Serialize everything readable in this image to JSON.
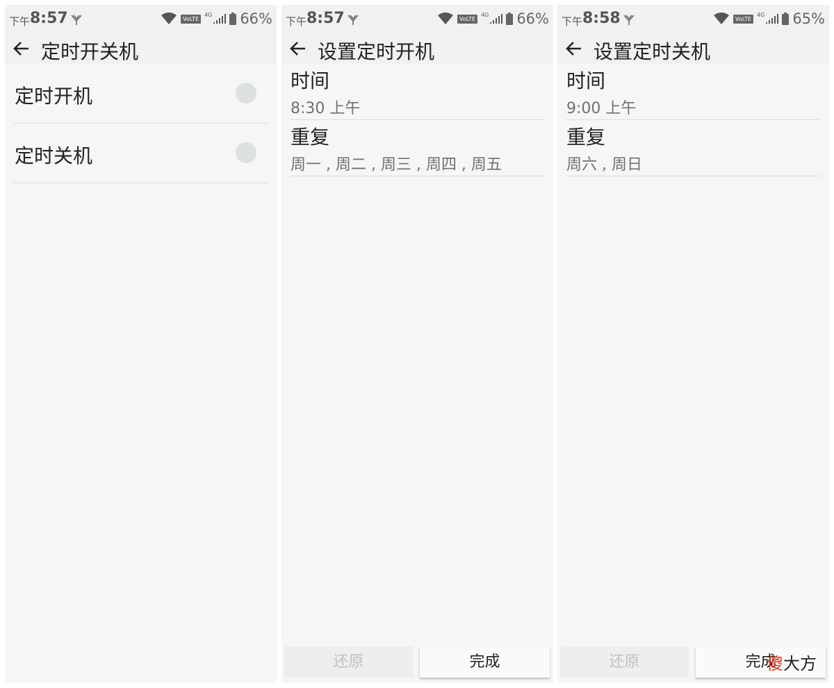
{
  "screens": [
    {
      "status": {
        "ampm": "下午",
        "time": "8:57",
        "battery": "66%",
        "network": "4G",
        "volte": "VoLTE"
      },
      "appbar": {
        "title": "定时开关机"
      },
      "switches": [
        {
          "label": "定时开机",
          "on": false
        },
        {
          "label": "定时关机",
          "on": false
        }
      ]
    },
    {
      "status": {
        "ampm": "下午",
        "time": "8:57",
        "battery": "66%",
        "network": "4G",
        "volte": "VoLTE"
      },
      "appbar": {
        "title": "设置定时开机"
      },
      "time_pref": {
        "title": "时间",
        "value": "8:30 上午"
      },
      "repeat_pref": {
        "title": "重复",
        "value": "周一 , 周二 , 周三 , 周四 , 周五"
      },
      "buttons": {
        "reset": "还原",
        "done": "完成"
      }
    },
    {
      "status": {
        "ampm": "下午",
        "time": "8:58",
        "battery": "65%",
        "network": "4G",
        "volte": "VoLTE"
      },
      "appbar": {
        "title": "设置定时关机"
      },
      "time_pref": {
        "title": "时间",
        "value": "9:00 上午"
      },
      "repeat_pref": {
        "title": "重复",
        "value": "周六 , 周日"
      },
      "buttons": {
        "reset": "还原",
        "done": "完成"
      },
      "watermark": {
        "red_char": "傻",
        "rest": "大方"
      }
    }
  ],
  "colors": {
    "panel_bg": "#f6f6f6",
    "bar_bg": "#f1f1f1",
    "toggle_off": "#dde0e1",
    "watermark_red": "#d83a1c"
  }
}
